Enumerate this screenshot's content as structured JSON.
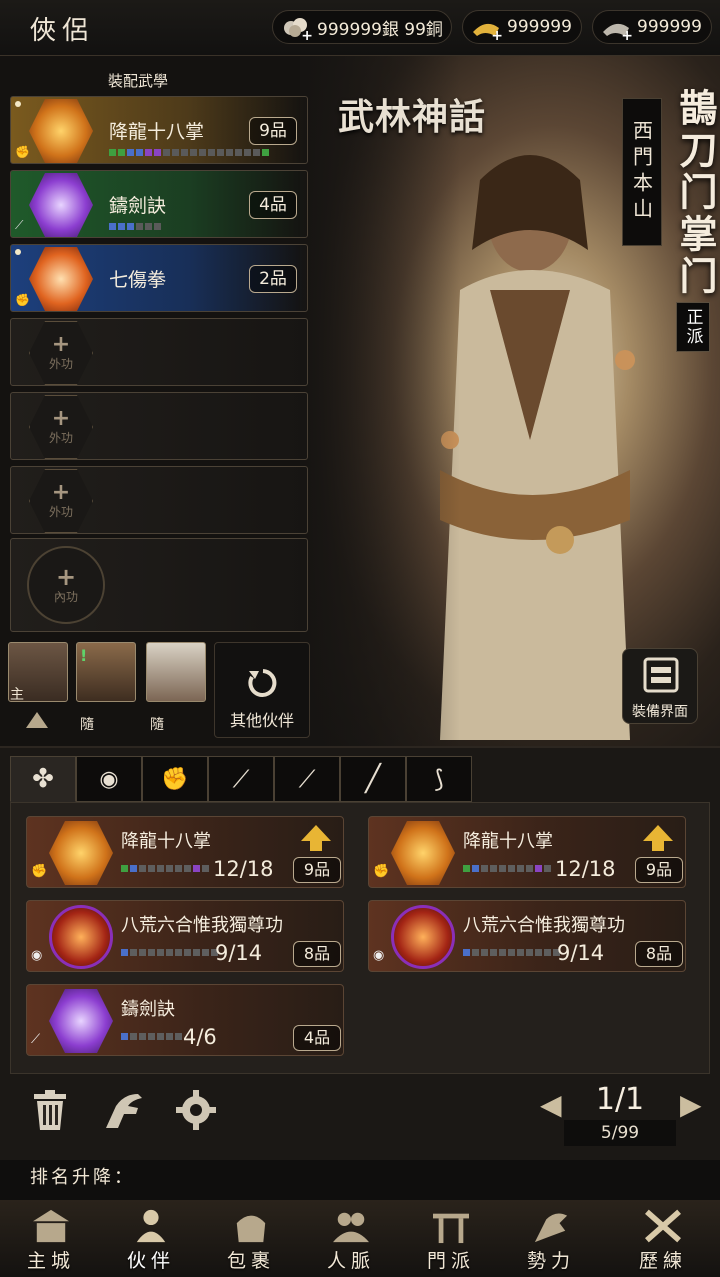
{
  "header": {
    "title": "俠侶",
    "currencies": [
      {
        "icon": "silver-coins-icon",
        "value": "999999銀 99銅"
      },
      {
        "icon": "gold-ingot-icon",
        "value": "999999"
      },
      {
        "icon": "silver-ingot-icon",
        "value": "999999"
      }
    ]
  },
  "hero": {
    "logo": "武林神話",
    "location": "西門本山",
    "rank": "鵲刀门掌门",
    "faction": "正派",
    "equip_button": "裝備界面"
  },
  "equipped": {
    "heading": "裝配武學",
    "slots": [
      {
        "name": "降龍十八掌",
        "grade": "9品",
        "type": "palm-icon",
        "color": "#c87a1e"
      },
      {
        "name": "鑄劍訣",
        "grade": "4品",
        "type": "sword-icon",
        "color": "#7b3cc9"
      },
      {
        "name": "七傷拳",
        "grade": "2品",
        "type": "fist-icon",
        "color": "#d2591b"
      }
    ],
    "empty_label": "外功",
    "inner_label": "內功"
  },
  "companions": {
    "items": [
      {
        "tag": "主",
        "name": "hero-portrait"
      },
      {
        "tag": "隨",
        "name": "companion-portrait"
      },
      {
        "tag": "隨",
        "name": "panda-portrait"
      }
    ],
    "other_button": "其他伙伴"
  },
  "inventory": {
    "tabs": [
      "all-icon",
      "inner-icon",
      "fist-icon",
      "sword-icon",
      "blade-icon",
      "staff-icon",
      "whip-icon"
    ],
    "items": [
      {
        "name": "降龍十八掌",
        "count": "12/18",
        "grade": "9品",
        "upgrade": true
      },
      {
        "name": "降龍十八掌",
        "count": "12/18",
        "grade": "9品",
        "upgrade": true
      },
      {
        "name": "八荒六合惟我獨尊功",
        "count": "9/14",
        "grade": "8品",
        "upgrade": false
      },
      {
        "name": "八荒六合惟我獨尊功",
        "count": "9/14",
        "grade": "8品",
        "upgrade": false
      },
      {
        "name": "鑄劍訣",
        "count": "4/6",
        "grade": "4品",
        "upgrade": false
      }
    ],
    "page": "1/1",
    "capacity": "5/99"
  },
  "ranking": {
    "label": "排名升降："
  },
  "nav": [
    "主城",
    "伙伴",
    "包裹",
    "人脈",
    "門派",
    "勢力",
    "歷練"
  ]
}
